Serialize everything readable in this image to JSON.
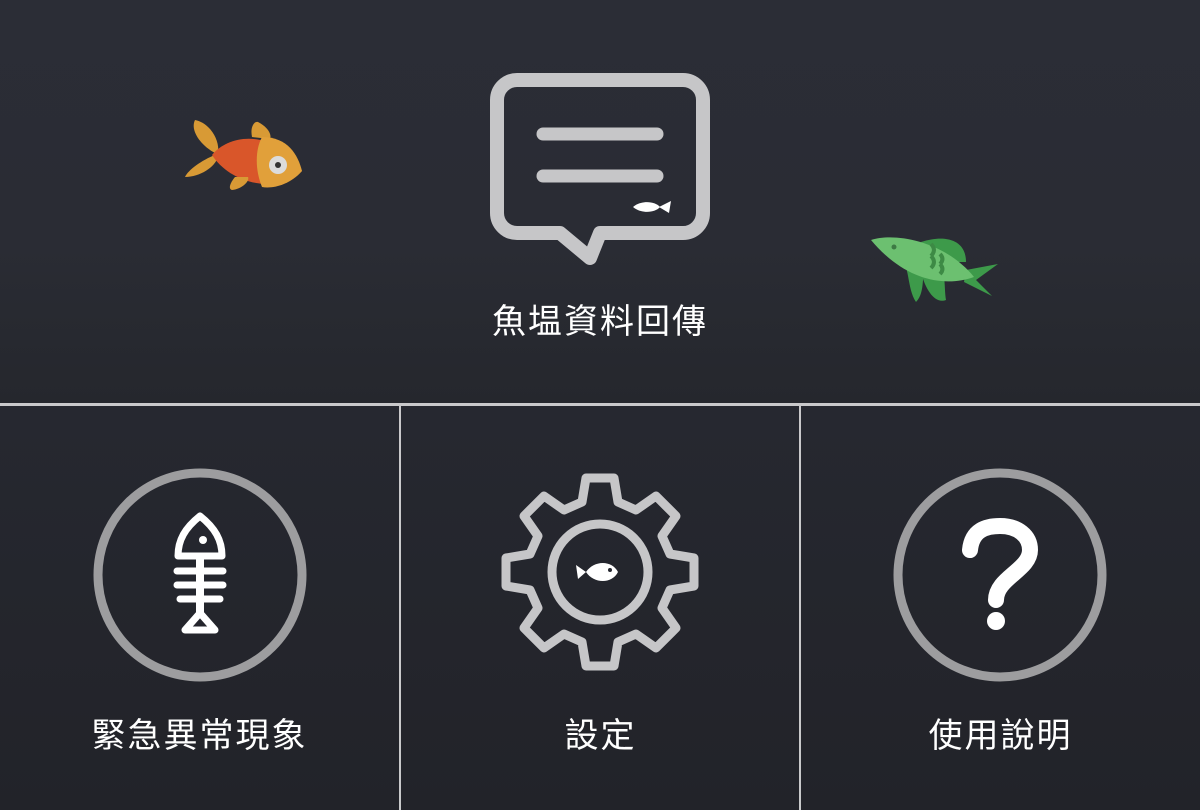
{
  "top": {
    "label": "魚塭資料回傳",
    "icon": "chat-bubble-fish-icon"
  },
  "tiles": [
    {
      "label": "緊急異常現象",
      "icon": "fish-bone-icon"
    },
    {
      "label": "設定",
      "icon": "gear-fish-icon"
    },
    {
      "label": "使用說明",
      "icon": "question-icon"
    }
  ],
  "colors": {
    "icon_gray": "#c6c6c8",
    "circle_gray": "#9d9d9f",
    "divider": "#c9c9cb",
    "orange_fish": "#d9562a",
    "green_fish": "#6cc070"
  }
}
